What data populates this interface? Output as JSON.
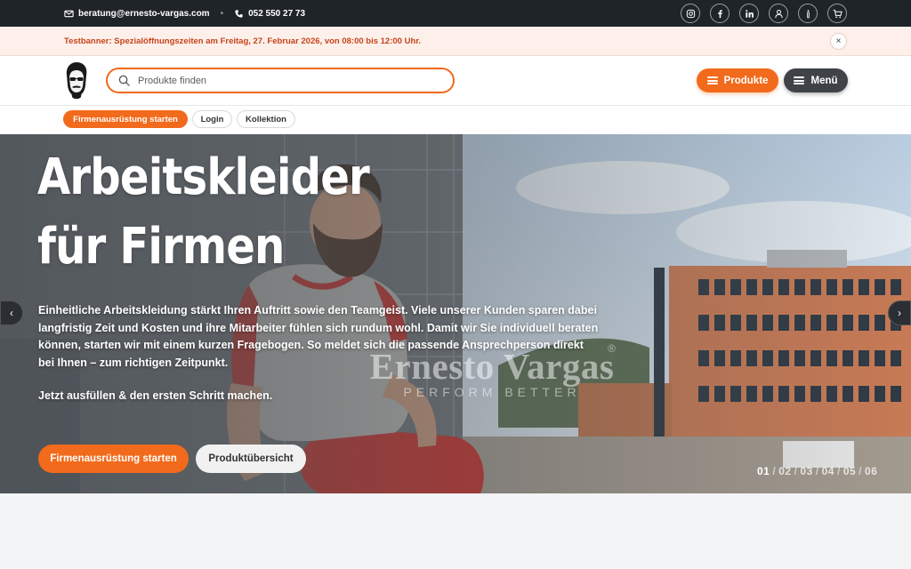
{
  "topbar": {
    "email": "beratung@ernesto-vargas.com",
    "phone": "052 550 27 73",
    "social_icons": [
      "instagram-icon",
      "facebook-icon",
      "linkedin-icon"
    ],
    "utility_icons": [
      "user-icon",
      "info-icon",
      "cart-icon"
    ]
  },
  "banner": {
    "text": "Testbanner: Spezialöffnungszeiten am Freitag, 27. Februar 2026, von 08:00 bis 12:00 Uhr.",
    "close_label": "×"
  },
  "header": {
    "search_placeholder": "Produkte finden",
    "produkte_label": "Produkte",
    "menu_label": "Menü"
  },
  "subnav": {
    "items": [
      "Firmenausrüstung starten",
      "Login",
      "Kollektion"
    ]
  },
  "hero": {
    "title_line1": "Arbeitskleider",
    "title_line2": "für Firmen",
    "lead": "Einheitliche Arbeitskleidung stärkt Ihren Auftritt sowie den Teamgeist. Viele unserer Kunden sparen dabei langfristig Zeit und Kosten und ihre Mitarbeiter fühlen sich rundum wohl. Damit wir Sie individuell beraten können, starten wir mit einem kurzen Fragebogen. So meldet sich die passende Ansprechperson direkt bei Ihnen – zum richtigen Zeitpunkt.",
    "cta_line": "Jetzt ausfüllen & den ersten Schritt machen.",
    "primary_button": "Firmenausrüstung starten",
    "secondary_button": "Produktübersicht",
    "brand_name": "Ernesto Vargas",
    "brand_reg": "®",
    "brand_tagline": "PERFORM BETTER",
    "prev_label": "‹",
    "next_label": "›",
    "slides": [
      "01",
      "02",
      "03",
      "04",
      "05",
      "06"
    ],
    "active_slide": "01"
  },
  "colors": {
    "accent": "#f26a1b",
    "topbar": "#1f2429",
    "banner_bg": "#fdf0ea",
    "banner_text": "#c7431b",
    "menu_button": "#3f4347"
  }
}
